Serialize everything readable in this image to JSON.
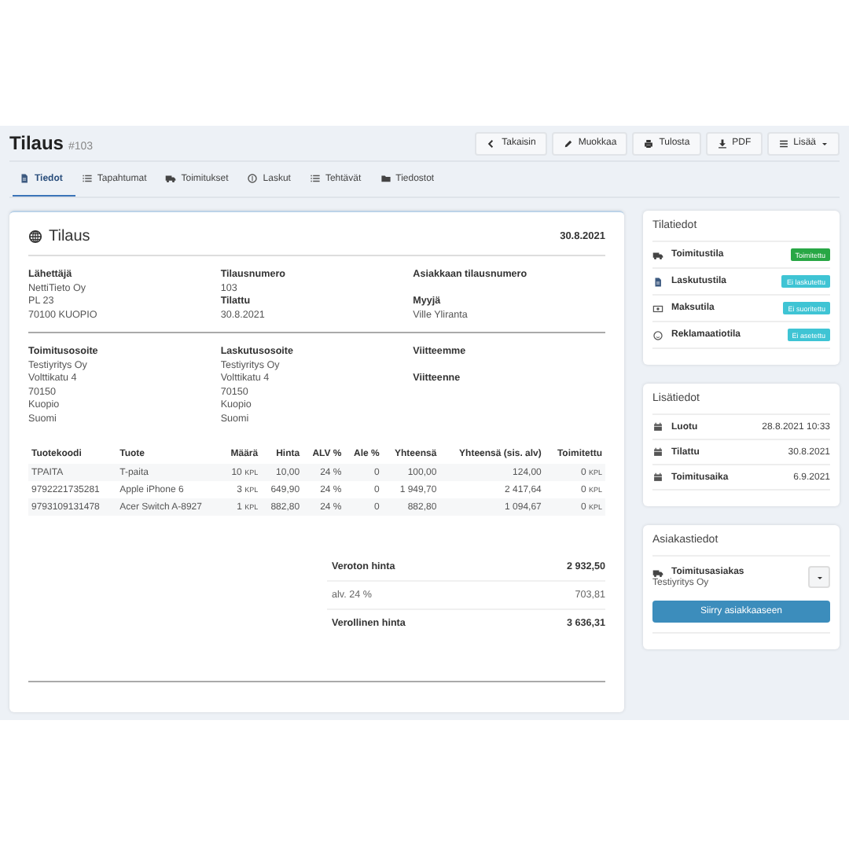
{
  "header": {
    "title": "Tilaus",
    "number": "#103"
  },
  "actions": [
    {
      "label": "Takaisin",
      "kind": "chevron"
    },
    {
      "label": "Muokkaa",
      "kind": "pencil"
    },
    {
      "label": "Tulosta",
      "kind": "printer"
    },
    {
      "label": "PDF",
      "kind": "download"
    },
    {
      "label": "Lisää",
      "kind": "menu"
    }
  ],
  "tabs": [
    {
      "label": "Tiedot",
      "kind": "file",
      "selected": true
    },
    {
      "label": "Tapahtumat",
      "kind": "list",
      "selected": false
    },
    {
      "label": "Toimitukset",
      "kind": "truck",
      "selected": false
    },
    {
      "label": "Laskut",
      "kind": "coin",
      "selected": false
    },
    {
      "label": "Tehtävät",
      "kind": "list",
      "selected": false
    },
    {
      "label": "Tiedostot",
      "kind": "folder",
      "selected": false
    }
  ],
  "order": {
    "title": "Tilaus",
    "date": "30.8.2021",
    "sections": [
      [
        [
          {
            "label": "Lähettäjä",
            "lines": [
              "NettiTieto Oy",
              "PL 23",
              "70100 KUOPIO"
            ]
          }
        ],
        [
          {
            "label": "Tilausnumero",
            "lines": [
              "103"
            ]
          },
          {
            "label": "Tilattu",
            "lines": [
              "30.8.2021"
            ]
          }
        ],
        [
          {
            "label": "Asiakkaan tilausnumero"
          },
          {
            "label": "Myyjä",
            "lines": [
              "Ville Yliranta"
            ]
          }
        ]
      ],
      [
        [
          {
            "label": "Toimitusosoite",
            "lines": [
              "Testiyritys Oy",
              "Volttikatu 4",
              "70150",
              "Kuopio",
              "Suomi"
            ]
          }
        ],
        [
          {
            "label": "Laskutusosoite",
            "lines": [
              "Testiyritys Oy",
              "Volttikatu 4",
              "70150",
              "Kuopio",
              "Suomi"
            ]
          }
        ],
        [
          {
            "label": "Viitteemme"
          },
          {
            "label": "Viitteenne"
          }
        ]
      ]
    ],
    "table": {
      "columns": [
        "Tuotekoodi",
        "Tuote",
        "Määrä",
        "Hinta",
        "ALV %",
        "Ale %",
        "Yhteensä",
        "Yhteensä (sis. alv)",
        "Toimitettu"
      ],
      "rows": [
        {
          "code": "TPAITA",
          "product": "T-paita",
          "quantity": "10",
          "quantity_unit": "KPL",
          "price": "10,00",
          "vat": "24 %",
          "discount": "0",
          "total": "100,00",
          "total_vat": "124,00",
          "delivered": "0",
          "delivered_unit": "KPL"
        },
        {
          "code": "9792221735281",
          "product": "Apple iPhone 6",
          "quantity": "3",
          "quantity_unit": "KPL",
          "price": "649,90",
          "vat": "24 %",
          "discount": "0",
          "total": "1 949,70",
          "total_vat": "2 417,64",
          "delivered": "0",
          "delivered_unit": "KPL"
        },
        {
          "code": "9793109131478",
          "product": "Acer Switch A-8927",
          "quantity": "1",
          "quantity_unit": "KPL",
          "price": "882,80",
          "vat": "24 %",
          "discount": "0",
          "total": "882,80",
          "total_vat": "1 094,67",
          "delivered": "0",
          "delivered_unit": "KPL"
        }
      ]
    },
    "totals": [
      {
        "label": "Veroton hinta",
        "value": "2 932,50",
        "bold": true
      },
      {
        "label": "alv. 24 %",
        "value": "703,81",
        "bold": false
      },
      {
        "label": "Verollinen hinta",
        "value": "3 636,31",
        "bold": true
      }
    ]
  },
  "status_panel": {
    "title": "Tilatiedot",
    "rows": [
      {
        "label": "Toimitustila",
        "kind": "truck",
        "badge": "Toimitettu",
        "color": "#28a745"
      },
      {
        "label": "Laskutustila",
        "kind": "file",
        "badge": "Ei laskutettu",
        "color": "#3fc4d4"
      },
      {
        "label": "Maksutila",
        "kind": "money",
        "badge": "Ei suoritettu",
        "color": "#3fc4d4"
      },
      {
        "label": "Reklamaatiotila",
        "kind": "circle",
        "badge": "Ei asetettu",
        "color": "#3fc4d4"
      }
    ]
  },
  "info_panel": {
    "title": "Lisätiedot",
    "rows": [
      {
        "label": "Luotu",
        "kind": "calendar",
        "value": "28.8.2021 10:33"
      },
      {
        "label": "Tilattu",
        "kind": "calendar",
        "value": "30.8.2021"
      },
      {
        "label": "Toimitusaika",
        "kind": "calendar",
        "value": "6.9.2021"
      }
    ]
  },
  "customer_panel": {
    "title": "Asiakastiedot",
    "label": "Toimitusasiakas",
    "kind": "truck",
    "name": "Testiyritys Oy",
    "button": "Siirry asiakkaaseen"
  }
}
